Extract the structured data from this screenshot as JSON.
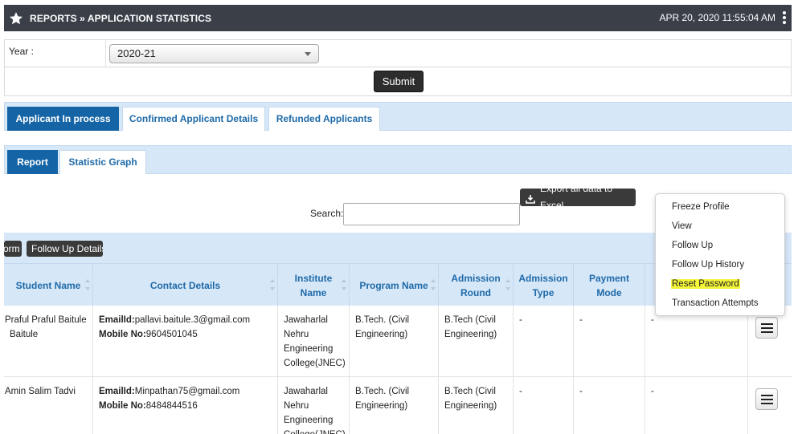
{
  "header": {
    "title": "REPORTS » APPLICATION STATISTICS",
    "datetime": "APR 20, 2020   11:55:04 AM",
    "icon": "star-icon"
  },
  "filter": {
    "year_label": "Year :",
    "year_value": "2020-21",
    "submit_label": "Submit"
  },
  "tabs_primary": [
    "Applicant In process",
    "Confirmed Applicant Details",
    "Refunded Applicants"
  ],
  "tabs_secondary": [
    "Report",
    "Statistic Graph"
  ],
  "export_label": "Export all data to Excel",
  "search_label": "Search:",
  "toolbar_buttons": [
    "orm",
    "Follow Up Details"
  ],
  "columns": [
    "Student Name",
    "Contact Details",
    "Institute Name",
    "Program Name",
    "Admission Round",
    "Admission Type",
    "Payment Mode"
  ],
  "rows": [
    {
      "student_name": "Praful Praful Baitule Baitule",
      "email_label": "EmailId:",
      "email": "pallavi.baitule.3@gmail.com",
      "mobile_label": "Mobile No:",
      "mobile": "9604501045",
      "institute": "Jawaharlal Nehru Engineering College(JNEC)",
      "program": "B.Tech. (Civil Engineering)",
      "round": "B.Tech (Civil Engineering)",
      "type": "-",
      "payment": "-",
      "extra": "-"
    },
    {
      "student_name": "Amin Salim Tadvi",
      "email_label": "EmailId:",
      "email": "Minpathan75@gmail.com",
      "mobile_label": "Mobile No:",
      "mobile": "8484844516",
      "institute": "Jawaharlal Nehru Engineering College(JNEC)",
      "program": "B.Tech. (Civil Engineering)",
      "round": "B.Tech (Civil Engineering)",
      "type": "-",
      "payment": "-",
      "extra": "-"
    }
  ],
  "dropdown_menu": [
    "Freeze Profile",
    "View",
    "Follow Up",
    "Follow Up History",
    "Reset Password",
    "Transaction Attempts"
  ],
  "colors": {
    "header_bg": "#3a3f48",
    "tab_active": "#1565a6",
    "tab_bar": "#d6e7f8",
    "highlight": "#f5f53a"
  }
}
